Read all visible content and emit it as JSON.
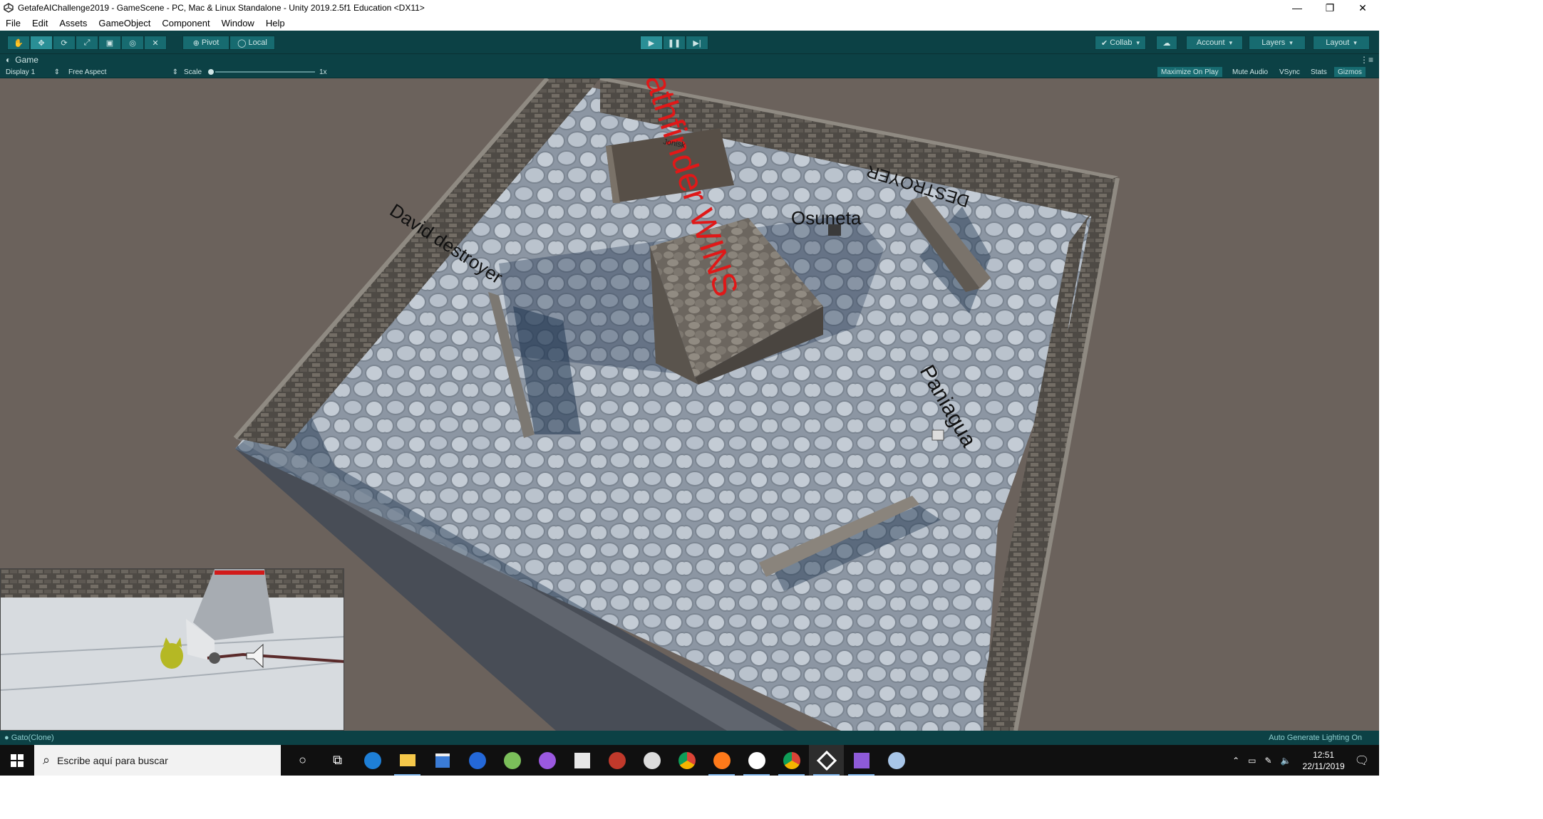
{
  "window": {
    "title": "GetafeAIChallenge2019 - GameScene - PC, Mac & Linux Standalone - Unity 2019.2.5f1 Education <DX11>",
    "controls": [
      "—",
      "❐",
      "✕"
    ]
  },
  "menu": [
    "File",
    "Edit",
    "Assets",
    "GameObject",
    "Component",
    "Window",
    "Help"
  ],
  "toolbar": {
    "pivot": "Pivot",
    "local": "Local",
    "collab": "Collab",
    "account": "Account",
    "layers": "Layers",
    "layout": "Layout"
  },
  "game_tab": {
    "label": "Game",
    "display": "Display 1",
    "aspect": "Free Aspect",
    "scale_label": "Scale",
    "scale_value": "1x",
    "maximize": "Maximize On Play",
    "mute": "Mute Audio",
    "vsync": "VSync",
    "stats": "Stats",
    "gizmos": "Gizmos"
  },
  "scene": {
    "labels": {
      "pathfinder": "athfinder WINS",
      "destroyer": "DESTROYER",
      "david": "David destroyer",
      "osuneta": "Osuneta",
      "paniagua": "Paniagua",
      "small": "Jonisk"
    }
  },
  "status": {
    "selected": "Gato(Clone)",
    "lighting": "Auto Generate Lighting On"
  },
  "taskbar": {
    "search_placeholder": "Escribe aquí para buscar",
    "time": "12:51",
    "date": "22/11/2019"
  },
  "colors": {
    "editor_bg": "#0c4145",
    "accent": "#2a8f96",
    "pathfinder_text": "#e01818"
  }
}
